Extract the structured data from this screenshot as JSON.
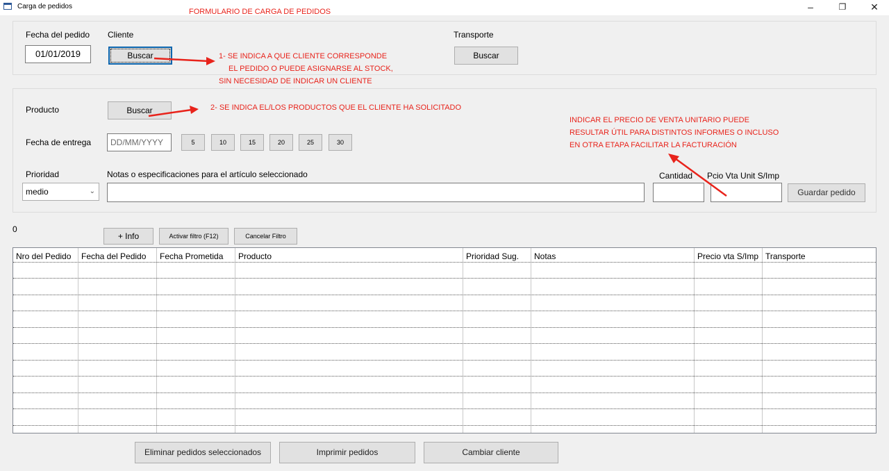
{
  "window": {
    "title": "Carga de pedidos",
    "minimize": "–",
    "maximize": "❐",
    "close": "✕"
  },
  "annotations": {
    "header": "FORMULARIO DE CARGA DE PEDIDOS",
    "client_note_1": "1- SE INDICA A QUE CLIENTE CORRESPONDE",
    "client_note_2": "EL PEDIDO O PUEDE ASIGNARSE AL STOCK,",
    "client_note_3": "SIN NECESIDAD DE INDICAR UN CLIENTE",
    "product_note": "2- SE INDICA EL/LOS PRODUCTOS QUE EL CLIENTE HA SOLICITADO",
    "price_note_1": "INDICAR EL PRECIO DE VENTA UNITARIO PUEDE",
    "price_note_2": "RESULTAR ÚTIL PARA DISTINTOS INFORMES O INCLUSO",
    "price_note_3": "EN OTRA ETAPA FACILITAR LA FACTURACIÓN",
    "color": "#e8231b"
  },
  "order_header": {
    "date_label": "Fecha del pedido",
    "date_value": "01/01/2019",
    "client_label": "Cliente",
    "client_button": "Buscar",
    "transport_label": "Transporte",
    "transport_button": "Buscar"
  },
  "item_panel": {
    "product_label": "Producto",
    "product_button": "Buscar",
    "delivery_label": "Fecha de entrega",
    "delivery_placeholder": "DD/MM/YYYY",
    "day_buttons": [
      "5",
      "10",
      "15",
      "20",
      "25",
      "30"
    ],
    "priority_label": "Prioridad",
    "priority_value": "medio",
    "notes_label": "Notas o especificaciones para el artículo seleccionado",
    "quantity_label": "Cantidad",
    "price_label": "Pcio Vta Unit S/Imp",
    "save_button": "Guardar pedido"
  },
  "toolbar": {
    "count": "0",
    "info_button": "+ Info",
    "filter_button": "Activar filtro (F12)",
    "cancel_filter_button": "Cancelar Filtro"
  },
  "grid": {
    "columns": [
      "Nro del Pedido",
      "Fecha del Pedido",
      "Fecha Prometida",
      "Producto",
      "Prioridad Sug.",
      "Notas",
      "Precio vta S/Imp",
      "Transporte"
    ]
  },
  "footer": {
    "delete_button": "Eliminar pedidos seleccionados",
    "print_button": "Imprimir pedidos",
    "change_client_button": "Cambiar cliente"
  }
}
